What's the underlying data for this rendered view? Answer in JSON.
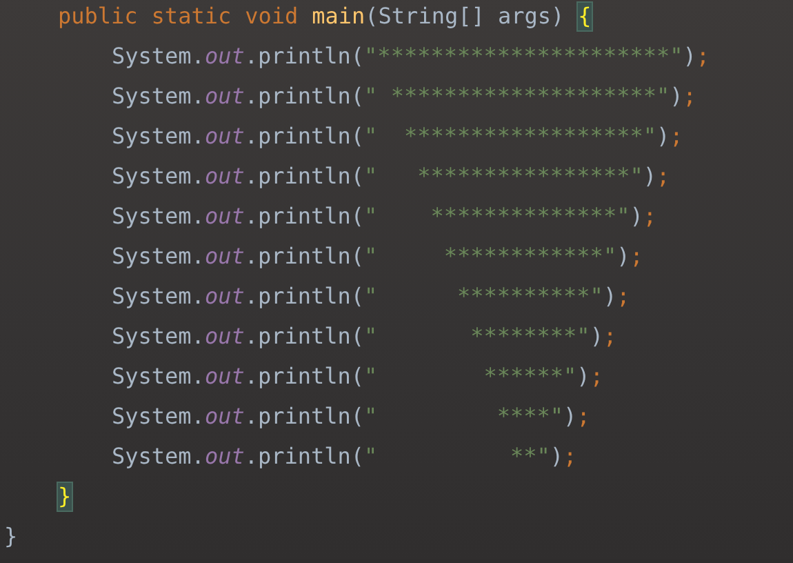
{
  "method": {
    "tokens": [
      {
        "kind": "keyword",
        "text": "public"
      },
      {
        "kind": "keyword",
        "text": "static"
      },
      {
        "kind": "keyword",
        "text": "void"
      },
      {
        "kind": "method",
        "text": "main"
      },
      {
        "kind": "plain",
        "text": "(String[] args)"
      },
      {
        "kind": "brace",
        "text": "{",
        "matched": true
      }
    ],
    "body": [
      {
        "tokens": [
          {
            "kind": "plain",
            "text": "System."
          },
          {
            "kind": "field",
            "text": "out"
          },
          {
            "kind": "plain",
            "text": ".println("
          },
          {
            "kind": "string",
            "text": "\"**********************\""
          },
          {
            "kind": "plain",
            "text": ")"
          },
          {
            "kind": "punct",
            "text": ";"
          }
        ]
      },
      {
        "tokens": [
          {
            "kind": "plain",
            "text": "System."
          },
          {
            "kind": "field",
            "text": "out"
          },
          {
            "kind": "plain",
            "text": ".println("
          },
          {
            "kind": "string",
            "text": "\" ********************\""
          },
          {
            "kind": "plain",
            "text": ")"
          },
          {
            "kind": "punct",
            "text": ";"
          }
        ]
      },
      {
        "tokens": [
          {
            "kind": "plain",
            "text": "System."
          },
          {
            "kind": "field",
            "text": "out"
          },
          {
            "kind": "plain",
            "text": ".println("
          },
          {
            "kind": "string",
            "text": "\"  ******************\""
          },
          {
            "kind": "plain",
            "text": ")"
          },
          {
            "kind": "punct",
            "text": ";"
          }
        ]
      },
      {
        "tokens": [
          {
            "kind": "plain",
            "text": "System."
          },
          {
            "kind": "field",
            "text": "out"
          },
          {
            "kind": "plain",
            "text": ".println("
          },
          {
            "kind": "string",
            "text": "\"   ****************\""
          },
          {
            "kind": "plain",
            "text": ")"
          },
          {
            "kind": "punct",
            "text": ";"
          }
        ]
      },
      {
        "tokens": [
          {
            "kind": "plain",
            "text": "System."
          },
          {
            "kind": "field",
            "text": "out"
          },
          {
            "kind": "plain",
            "text": ".println("
          },
          {
            "kind": "string",
            "text": "\"    **************\""
          },
          {
            "kind": "plain",
            "text": ")"
          },
          {
            "kind": "punct",
            "text": ";"
          }
        ]
      },
      {
        "tokens": [
          {
            "kind": "plain",
            "text": "System."
          },
          {
            "kind": "field",
            "text": "out"
          },
          {
            "kind": "plain",
            "text": ".println("
          },
          {
            "kind": "string",
            "text": "\"     ************\""
          },
          {
            "kind": "plain",
            "text": ")"
          },
          {
            "kind": "punct",
            "text": ";"
          }
        ]
      },
      {
        "tokens": [
          {
            "kind": "plain",
            "text": "System."
          },
          {
            "kind": "field",
            "text": "out"
          },
          {
            "kind": "plain",
            "text": ".println("
          },
          {
            "kind": "string",
            "text": "\"      **********\""
          },
          {
            "kind": "plain",
            "text": ")"
          },
          {
            "kind": "punct",
            "text": ";"
          }
        ]
      },
      {
        "tokens": [
          {
            "kind": "plain",
            "text": "System."
          },
          {
            "kind": "field",
            "text": "out"
          },
          {
            "kind": "plain",
            "text": ".println("
          },
          {
            "kind": "string",
            "text": "\"       ********\""
          },
          {
            "kind": "plain",
            "text": ")"
          },
          {
            "kind": "punct",
            "text": ";"
          }
        ]
      },
      {
        "tokens": [
          {
            "kind": "plain",
            "text": "System."
          },
          {
            "kind": "field",
            "text": "out"
          },
          {
            "kind": "plain",
            "text": ".println("
          },
          {
            "kind": "string",
            "text": "\"        ******\""
          },
          {
            "kind": "plain",
            "text": ")"
          },
          {
            "kind": "punct",
            "text": ";"
          }
        ]
      },
      {
        "tokens": [
          {
            "kind": "plain",
            "text": "System."
          },
          {
            "kind": "field",
            "text": "out"
          },
          {
            "kind": "plain",
            "text": ".println("
          },
          {
            "kind": "string",
            "text": "\"         ****\""
          },
          {
            "kind": "plain",
            "text": ")"
          },
          {
            "kind": "punct",
            "text": ";"
          }
        ]
      },
      {
        "tokens": [
          {
            "kind": "plain",
            "text": "System."
          },
          {
            "kind": "field",
            "text": "out"
          },
          {
            "kind": "plain",
            "text": ".println("
          },
          {
            "kind": "string",
            "text": "\"          **\""
          },
          {
            "kind": "plain",
            "text": ")"
          },
          {
            "kind": "punct",
            "text": ";"
          }
        ]
      }
    ],
    "close": {
      "kind": "brace",
      "text": "}",
      "matched": true
    }
  },
  "class_close": {
    "kind": "brace",
    "text": "}",
    "matched": false
  }
}
